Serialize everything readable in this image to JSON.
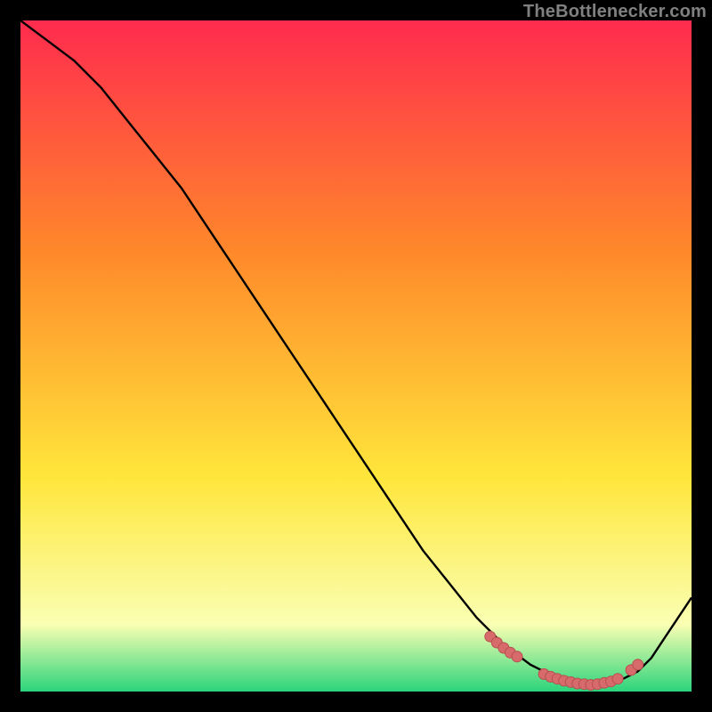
{
  "watermark": "TheBottlenecker.com",
  "colors": {
    "black": "#000000",
    "curve": "#000000",
    "dot_fill": "#d76a6a",
    "dot_stroke": "#b84f4f",
    "watermark": "#808080",
    "grad_top": "#ff2b4e",
    "grad_mid1": "#ff8a2a",
    "grad_mid2": "#ffe63b",
    "grad_mid3": "#faffb3",
    "grad_bottom": "#2bd47a"
  },
  "chart_data": {
    "type": "line",
    "title": "",
    "xlabel": "",
    "ylabel": "",
    "xlim": [
      0,
      100
    ],
    "ylim": [
      0,
      100
    ],
    "series": [
      {
        "name": "bottleneck-curve",
        "x": [
          0,
          4,
          8,
          12,
          16,
          20,
          24,
          28,
          32,
          36,
          40,
          44,
          48,
          52,
          56,
          60,
          64,
          68,
          72,
          76,
          80,
          82,
          84,
          86,
          88,
          90,
          92,
          94,
          96,
          98,
          100
        ],
        "y": [
          100,
          97,
          94,
          90,
          85,
          80,
          75,
          69,
          63,
          57,
          51,
          45,
          39,
          33,
          27,
          21,
          16,
          11,
          7,
          4,
          2,
          1,
          1,
          1,
          1,
          2,
          3,
          5,
          8,
          11,
          14
        ]
      }
    ],
    "dots": {
      "name": "highlight-points",
      "x": [
        70,
        71,
        72,
        73,
        74,
        78,
        79,
        80,
        81,
        82,
        83,
        84,
        85,
        86,
        87,
        88,
        89,
        91,
        92
      ],
      "y": [
        8.2,
        7.3,
        6.5,
        5.8,
        5.2,
        2.6,
        2.2,
        1.9,
        1.6,
        1.4,
        1.2,
        1.1,
        1.0,
        1.1,
        1.3,
        1.5,
        1.9,
        3.2,
        4.0
      ]
    }
  }
}
